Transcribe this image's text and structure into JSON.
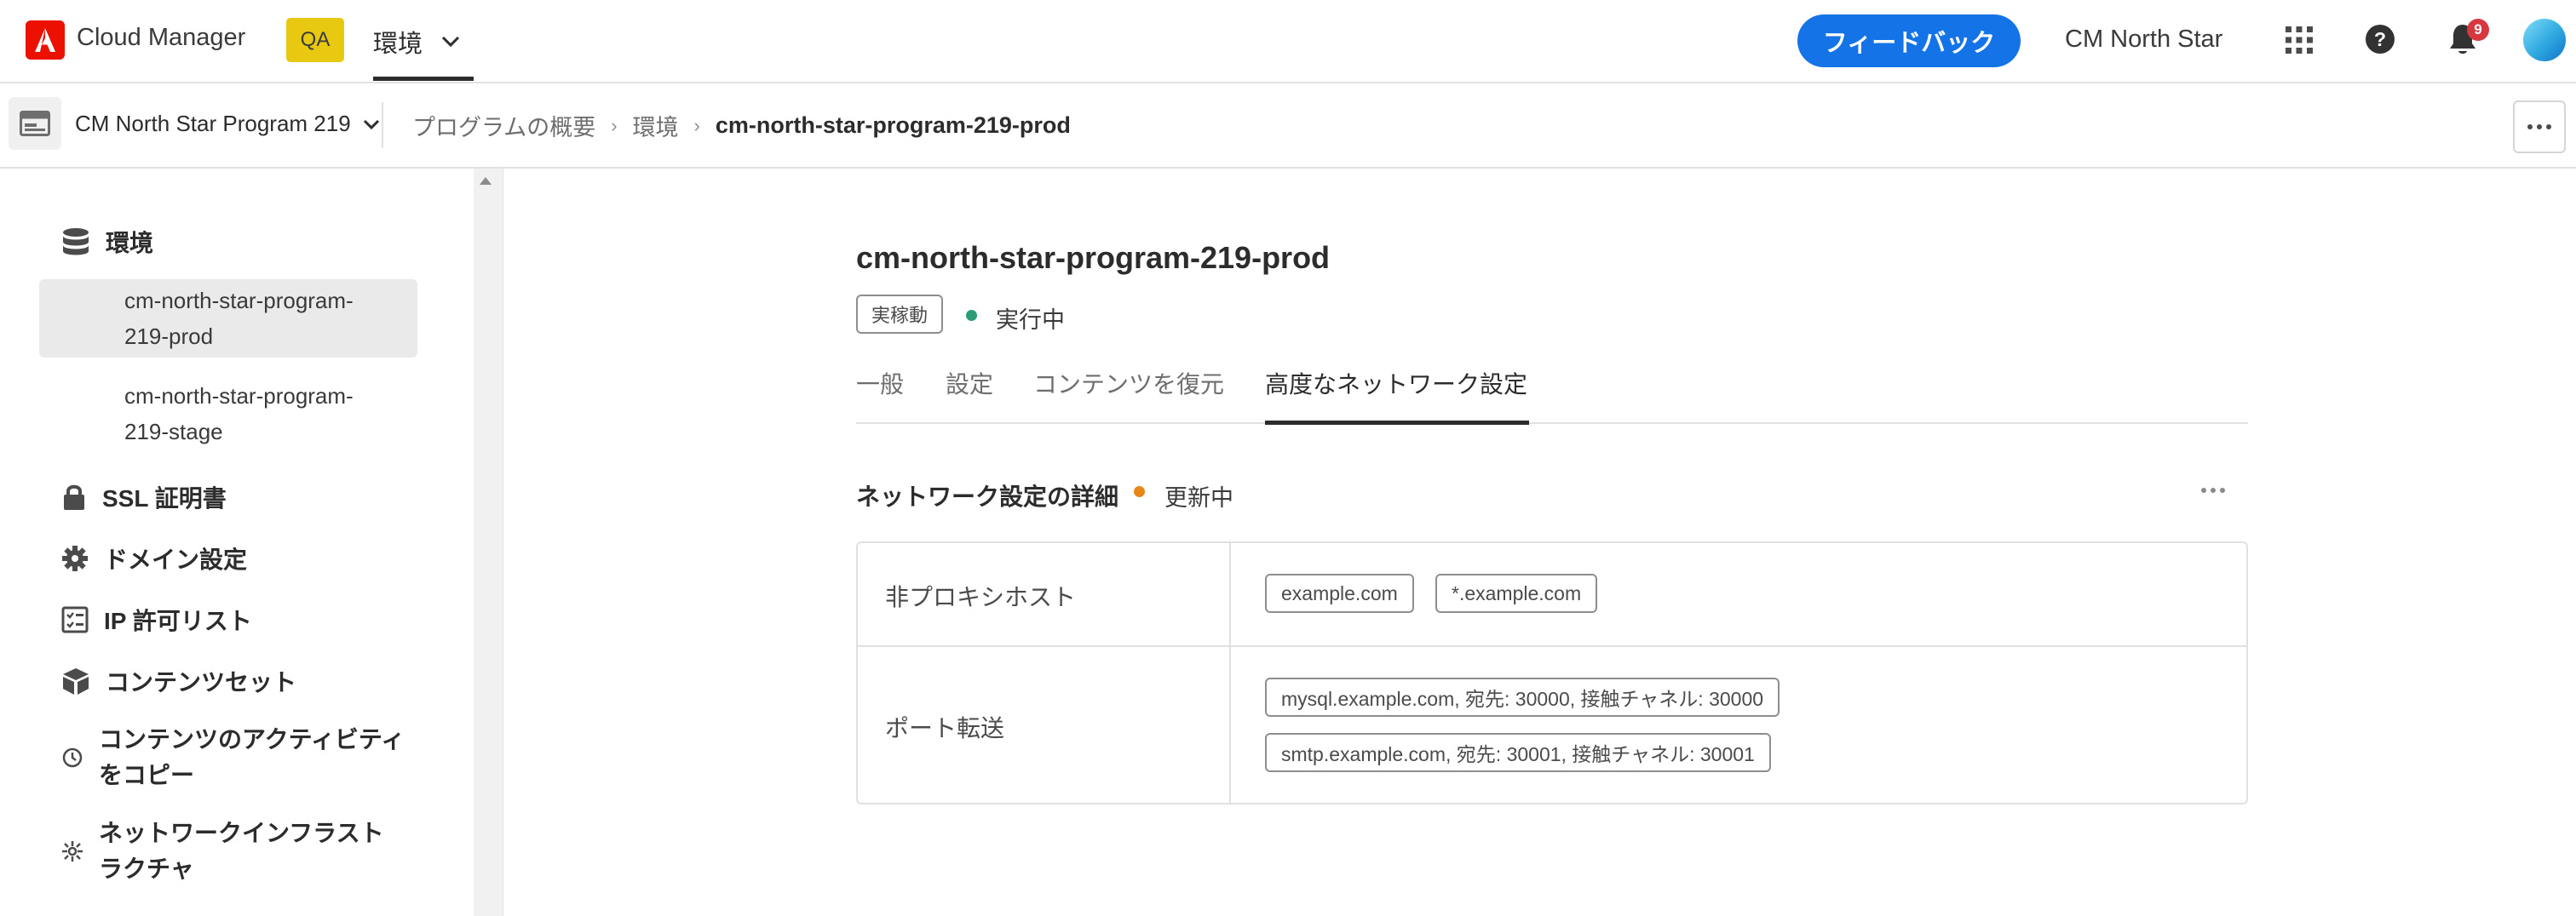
{
  "topbar": {
    "app_title": "Cloud Manager",
    "qa_badge": "QA",
    "environment_switch": "環境",
    "feedback_button": "フィードバック",
    "org_name": "CM North Star",
    "notification_count": "9",
    "brand_color": "#eb1000",
    "accent_color": "#1473e6",
    "icons": [
      "adobe-logo",
      "chevron-down-icon",
      "apps-grid-icon",
      "help-icon",
      "bell-icon",
      "avatar"
    ]
  },
  "subbar": {
    "program_name": "CM North Star Program 219",
    "breadcrumb": {
      "overview": "プログラムの概要",
      "environments": "環境",
      "current": "cm-north-star-program-219-prod"
    }
  },
  "sidebar": {
    "environments_label": "環境",
    "environment_items": [
      {
        "line1": "cm-north-star-program-",
        "line2": "219-prod",
        "selected": true
      },
      {
        "line1": "cm-north-star-program-",
        "line2": "219-stage",
        "selected": false
      }
    ],
    "items": [
      {
        "label": "SSL 証明書",
        "icon": "lock-icon"
      },
      {
        "label": "ドメイン設定",
        "icon": "gear-icon"
      },
      {
        "label": "IP 許可リスト",
        "icon": "checklist-icon"
      },
      {
        "label": "コンテンツセット",
        "icon": "box-icon"
      },
      {
        "line1": "コンテンツのアクティビティ",
        "line2": "をコピー",
        "icon": "history-icon"
      },
      {
        "line1": "ネットワークインフラスト",
        "line2": "ラクチャ",
        "icon": "network-icon"
      }
    ]
  },
  "main": {
    "title": "cm-north-star-program-219-prod",
    "status_tag": "実稼動",
    "status_text": "実行中",
    "status_color": "#2d9d78",
    "tabs": [
      {
        "label": "一般",
        "active": false
      },
      {
        "label": "設定",
        "active": false
      },
      {
        "label": "コンテンツを復元",
        "active": false
      },
      {
        "label": "高度なネットワーク設定",
        "active": true
      }
    ],
    "section": {
      "title": "ネットワーク設定の詳細",
      "status": "更新中",
      "status_color": "#e68619"
    },
    "table": {
      "rows": [
        {
          "label": "非プロキシホスト",
          "values": [
            "example.com",
            "*.example.com"
          ]
        },
        {
          "label": "ポート転送",
          "values": [
            "mysql.example.com, 宛先: 30000, 接触チャネル: 30000",
            "smtp.example.com, 宛先: 30001, 接触チャネル: 30001"
          ]
        }
      ]
    }
  }
}
